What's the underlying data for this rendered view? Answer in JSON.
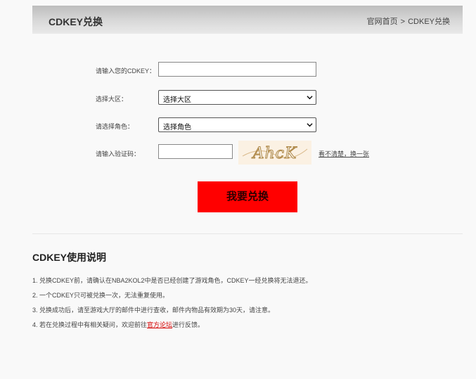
{
  "header": {
    "title": "CDKEY兑换",
    "breadcrumb": {
      "home": "官网首页",
      "separator": ">",
      "current": "CDKEY兑换"
    }
  },
  "form": {
    "cdkey_label": "请输入您的CDKEY：",
    "cdkey_value": "",
    "server_label": "选择大区：",
    "server_selected": "选择大区",
    "role_label": "请选择角色：",
    "role_selected": "选择角色",
    "captcha_label": "请输入验证码：",
    "captcha_value": "",
    "captcha_text": "AhcK",
    "refresh_link": "看不清楚，换一张",
    "submit_label": "我要兑换"
  },
  "help": {
    "title": "CDKEY使用说明",
    "notes": [
      "1. 兑换CDKEY前，请确认在NBA2KOL2中是否已经创建了游戏角色，CDKEY一经兑换将无法退还。",
      "2. 一个CDKEY只可被兑换一次，无法重复使用。",
      "3. 兑换成功后，请至游戏大厅的邮件中进行查收，邮件内物品有效期为30天，请注意。"
    ],
    "note4_prefix": "4. 若在兑换过程中有相关疑问，欢迎前往",
    "note4_link": "官方论坛",
    "note4_suffix": "进行反馈。"
  },
  "colors": {
    "submit": "#ff0000",
    "link": "#d40000"
  },
  "icons": {
    "select_caret": "chevron-down-icon"
  }
}
